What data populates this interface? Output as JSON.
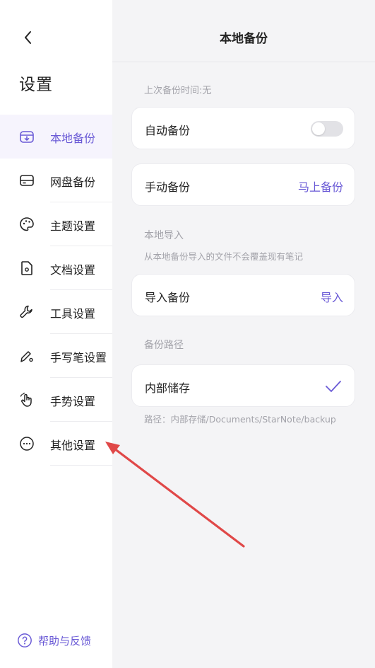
{
  "sidebar": {
    "title": "设置",
    "items": [
      {
        "label": "本地备份",
        "icon": "local-backup-icon",
        "active": true
      },
      {
        "label": "网盘备份",
        "icon": "cloud-drive-icon"
      },
      {
        "label": "主题设置",
        "icon": "palette-icon"
      },
      {
        "label": "文档设置",
        "icon": "document-gear-icon"
      },
      {
        "label": "工具设置",
        "icon": "wrench-icon"
      },
      {
        "label": "手写笔设置",
        "icon": "pen-gear-icon"
      },
      {
        "label": "手势设置",
        "icon": "hand-gesture-icon"
      },
      {
        "label": "其他设置",
        "icon": "more-circle-icon"
      }
    ],
    "help": {
      "label": "帮助与反馈",
      "icon": "help-circle-icon"
    }
  },
  "header": {
    "title": "本地备份"
  },
  "backup": {
    "last_backup": "上次备份时间:无",
    "auto_label": "自动备份",
    "auto_enabled": false,
    "manual_label": "手动备份",
    "manual_action": "马上备份"
  },
  "import": {
    "section_title": "本地导入",
    "note": "从本地备份导入的文件不会覆盖现有笔记",
    "label": "导入备份",
    "action": "导入"
  },
  "path": {
    "section_title": "备份路径",
    "option_label": "内部储存",
    "selected": true,
    "path_text": "路径：内部存储/Documents/StarNote/backup"
  },
  "colors": {
    "accent": "#6a5ad6",
    "annotation_arrow": "#e04848"
  }
}
